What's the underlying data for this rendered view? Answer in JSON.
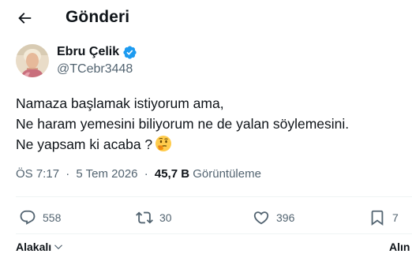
{
  "header": {
    "title": "Gönderi",
    "back_icon": "arrow-left-icon"
  },
  "author": {
    "name": "Ebru Çelik",
    "handle": "@TCebr3448",
    "verified_icon": "verified-badge-icon",
    "verified_color": "#1d9bf0"
  },
  "tweet": {
    "lines": [
      "Namaza başlamak istiyorum ama,",
      "Ne haram yemesini biliyorum ne de yalan söylemesini.",
      "Ne yapsam ki acaba ?"
    ],
    "emoji": "thinking-face-emoji"
  },
  "meta": {
    "time": "ÖS 7:17",
    "separator": "·",
    "date": "5 Tem 2026",
    "views_count": "45,7 B",
    "views_label": "Görüntüleme"
  },
  "actions": {
    "reply": {
      "icon": "reply-icon",
      "count": "558"
    },
    "repost": {
      "icon": "repost-icon",
      "count": "30"
    },
    "like": {
      "icon": "heart-icon",
      "count": "396"
    },
    "bookmark": {
      "icon": "bookmark-icon",
      "count": "7"
    }
  },
  "bottom": {
    "sort_label": "Alakalı",
    "right_label": "Alın"
  },
  "colors": {
    "text": "#0f1419",
    "secondary": "#536471",
    "border": "#eff3f4",
    "accent": "#1d9bf0"
  }
}
